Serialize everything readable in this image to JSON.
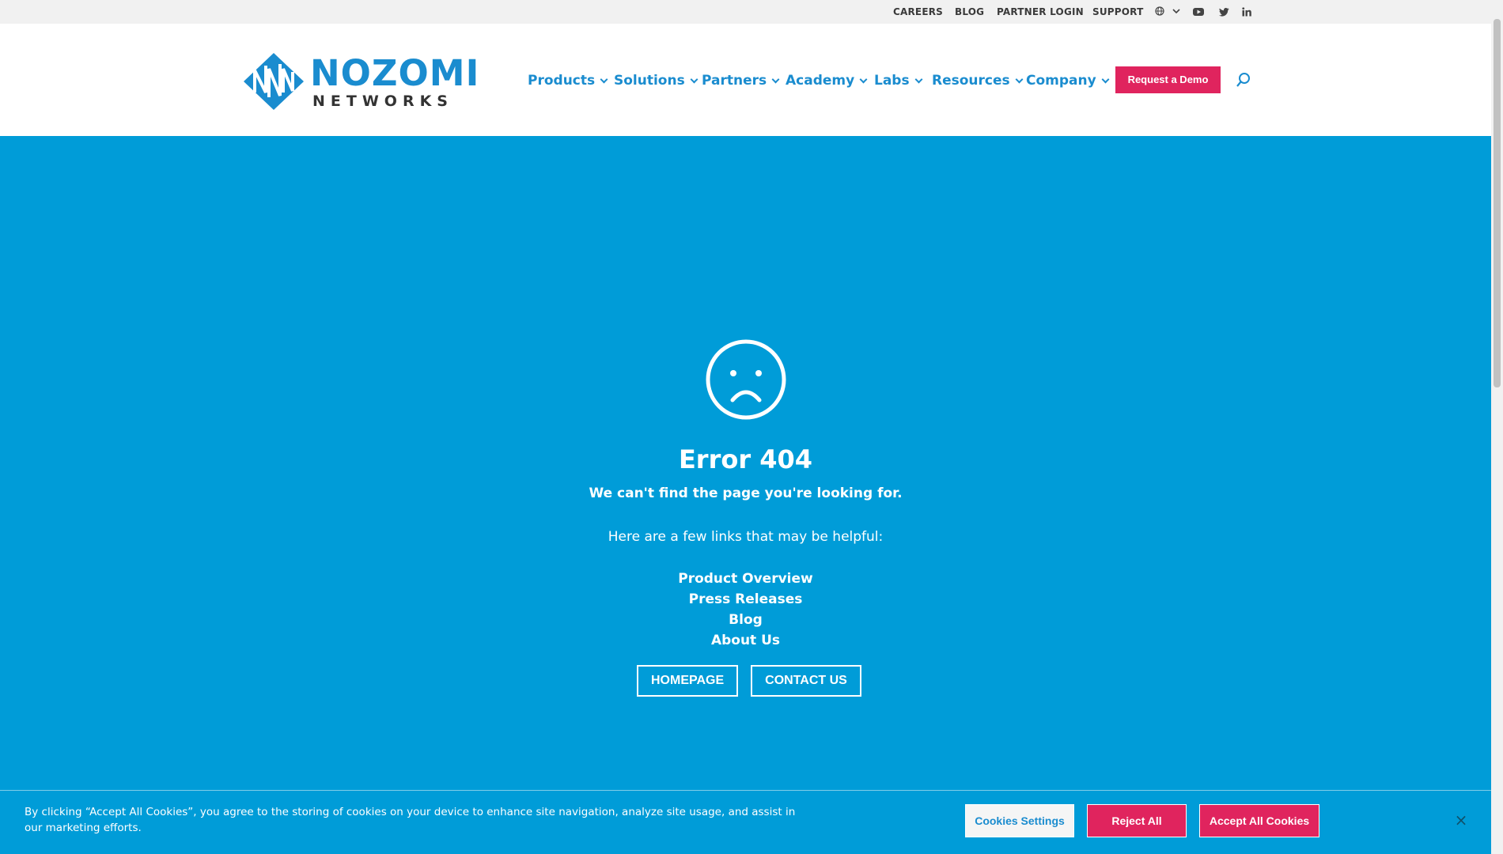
{
  "topbar": {
    "links": [
      "CAREERS",
      "BLOG",
      "PARTNER LOGIN",
      "SUPPORT"
    ],
    "language_icon": "globe-icon",
    "social": [
      {
        "name": "youtube-icon",
        "glyph": "▶"
      },
      {
        "name": "twitter-icon",
        "glyph": "t"
      },
      {
        "name": "linkedin-icon",
        "glyph": "in"
      }
    ]
  },
  "header": {
    "logo": {
      "word": "NOZOMI",
      "sub": "NETWORKS"
    },
    "nav": [
      "Products",
      "Solutions",
      "Partners",
      "Academy",
      "Labs",
      "Resources",
      "Company"
    ],
    "cta": "Request a Demo",
    "search_icon": "search-icon"
  },
  "error": {
    "icon": "sad-face-icon",
    "title": "Error 404",
    "subtitle": "We can't find the page you're looking for.",
    "helper": "Here are a few links that may be helpful:",
    "links": [
      "Product Overview",
      "Press Releases",
      "Blog",
      "About Us"
    ],
    "buttons": {
      "home": "HOMEPAGE",
      "contact": "CONTACT US"
    }
  },
  "cookie": {
    "text": "By clicking “Accept All Cookies”, you agree to the storing of cookies on your device to enhance site navigation, analyze site usage, and assist in our marketing efforts.",
    "settings": "Cookies Settings",
    "reject": "Reject All",
    "accept": "Accept All Cookies",
    "close": "×"
  },
  "colors": {
    "brand_blue": "#009cd8",
    "link_blue": "#1a8ccf",
    "accent_pink": "#e0245e"
  }
}
